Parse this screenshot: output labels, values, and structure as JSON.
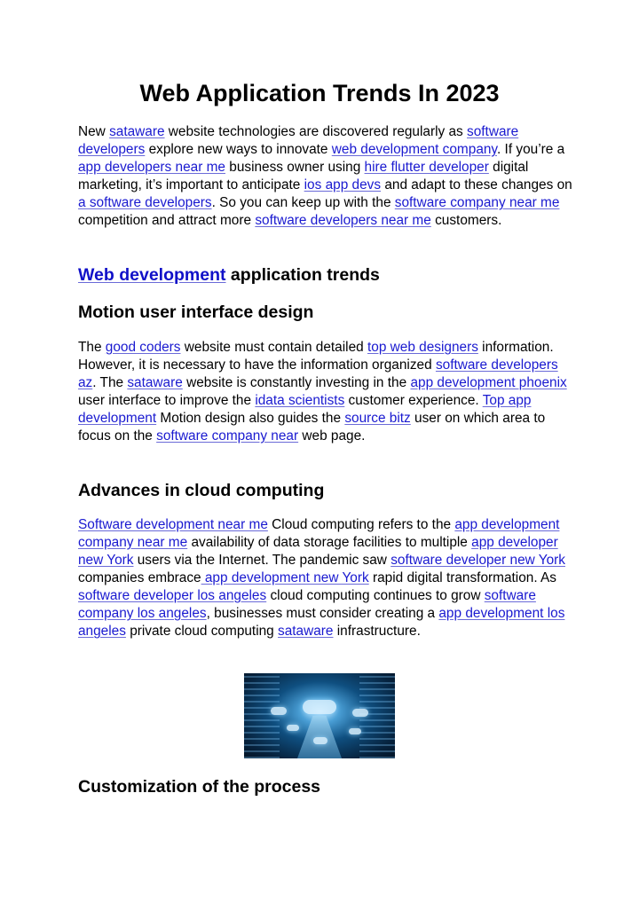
{
  "title": "Web Application Trends In 2023",
  "intro": [
    {
      "t": "New "
    },
    {
      "link": "sataware"
    },
    {
      "t": " website technologies are discovered regularly as "
    },
    {
      "link": "software developers"
    },
    {
      "t": " explore new ways to innovate "
    },
    {
      "link": "web development company"
    },
    {
      "t": ". If you’re a "
    },
    {
      "link": "app developers near me"
    },
    {
      "t": " business owner using "
    },
    {
      "link": "hire flutter developer"
    },
    {
      "t": " digital marketing, it’s important to anticipate "
    },
    {
      "link": "ios app devs"
    },
    {
      "t": " and adapt to these changes on "
    },
    {
      "link": "a software developers"
    },
    {
      "t": ". So you can keep up with the "
    },
    {
      "link": "software company near me"
    },
    {
      "t": " competition and attract more "
    },
    {
      "link": "software developers near me"
    },
    {
      "t": " customers."
    }
  ],
  "section_heading": {
    "link": "Web development",
    "text": " application trends"
  },
  "motion": {
    "heading": "Motion user interface design",
    "body": [
      {
        "t": "The "
      },
      {
        "link": "good coders"
      },
      {
        "t": " website must contain detailed "
      },
      {
        "link": "top web designers"
      },
      {
        "t": " information. However, it is necessary to have the information organized "
      },
      {
        "link": "software developers az"
      },
      {
        "t": ". The "
      },
      {
        "link": "sataware"
      },
      {
        "t": " website is constantly investing in the "
      },
      {
        "link": "app development phoenix"
      },
      {
        "t": " user interface to improve the "
      },
      {
        "link": "idata scientists"
      },
      {
        "t": " customer experience. "
      },
      {
        "link": "Top app development"
      },
      {
        "t": " Motion design also guides the "
      },
      {
        "link": "source bitz"
      },
      {
        "t": " user on which area to focus on the "
      },
      {
        "link": "software company near"
      },
      {
        "t": " web page."
      }
    ]
  },
  "cloud": {
    "heading": "Advances in cloud computing",
    "body": [
      {
        "link": "Software development near me"
      },
      {
        "t": " Cloud computing refers to the "
      },
      {
        "link": "app development company near me"
      },
      {
        "t": " availability of data storage facilities to multiple "
      },
      {
        "link": "app developer new York"
      },
      {
        "t": " users via the Internet. The pandemic saw "
      },
      {
        "link": "software developer new York"
      },
      {
        "t": " companies embrace"
      },
      {
        "link": " app development new York"
      },
      {
        "t": " rapid digital transformation. As "
      },
      {
        "link": "software developer los angeles"
      },
      {
        "t": " cloud computing continues to grow "
      },
      {
        "link": "software company los angeles"
      },
      {
        "t": ", businesses must consider creating a "
      },
      {
        "link": "app development los angeles"
      },
      {
        "t": " private cloud computing "
      },
      {
        "link": "sataware"
      },
      {
        "t": " infrastructure."
      }
    ],
    "image_alt": "cloud computing data center illustration"
  },
  "customization": {
    "heading": "Customization of the process"
  },
  "colors": {
    "link": "#1a1ad0",
    "text": "#000000",
    "background": "#ffffff"
  }
}
